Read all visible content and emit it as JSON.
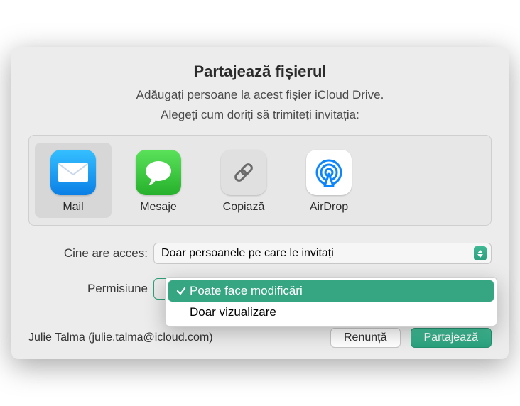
{
  "title": "Partajează fișierul",
  "subtitle": "Adăugați persoane la acest fișier iCloud Drive.",
  "prompt": "Alegeți cum doriți să trimiteți invitația:",
  "methods": [
    {
      "key": "mail",
      "label": "Mail",
      "selected": true
    },
    {
      "key": "messages",
      "label": "Mesaje",
      "selected": false
    },
    {
      "key": "copylink",
      "label": "Copiază",
      "selected": false
    },
    {
      "key": "airdrop",
      "label": "AirDrop",
      "selected": false
    }
  ],
  "access": {
    "label": "Cine are acces:",
    "value": "Doar persoanele pe care le invitați"
  },
  "permission": {
    "label": "Permisiune",
    "options": [
      {
        "label": "Poate face modificări",
        "selected": true
      },
      {
        "label": "Doar vizualizare",
        "selected": false
      }
    ]
  },
  "owner": "Julie Talma (julie.talma@icloud.com)",
  "buttons": {
    "cancel": "Renunță",
    "share": "Partajează"
  }
}
